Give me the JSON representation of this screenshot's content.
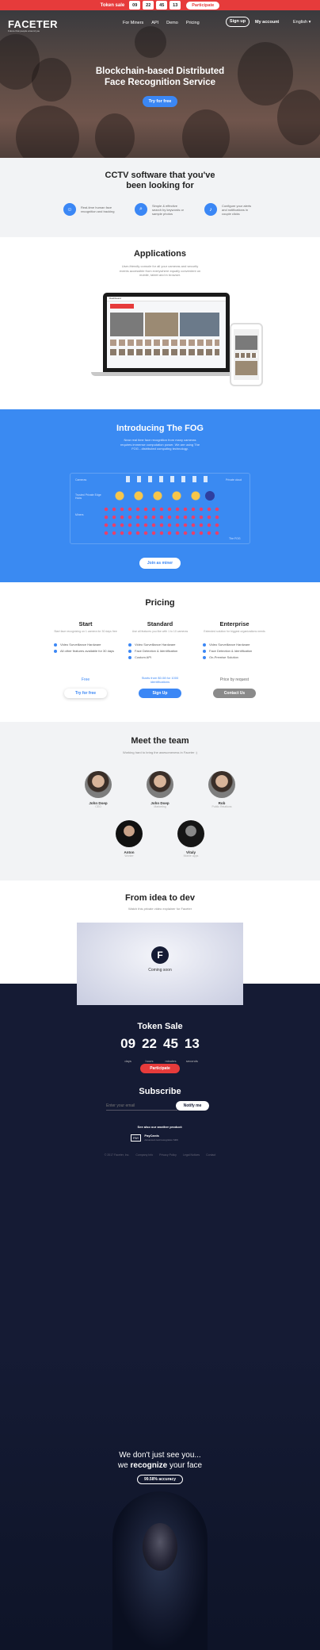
{
  "topbar": {
    "title": "Token sale",
    "days": "09",
    "days_lbl": "days",
    "hours": "22",
    "hours_lbl": "hours",
    "minutes": "45",
    "minutes_lbl": "minutes",
    "seconds": "13",
    "seconds_lbl": "seconds",
    "button": "Participate"
  },
  "nav": {
    "logo": "FACETER",
    "logo_tag": "Future that people around you",
    "links": [
      "For Miners",
      "API",
      "Demo",
      "Pricing"
    ],
    "signup": "Sign up",
    "account": "My account",
    "language": "English"
  },
  "hero": {
    "title_line1": "Blockchain-based Distributed",
    "title_line2": "Face Recognition Service",
    "cta": "Try for free"
  },
  "cctv": {
    "title_line1": "CCTV software that you've",
    "title_line2": "been looking for",
    "features": [
      {
        "icon": "user-icon",
        "text": "Real-time human face recognition and tracking"
      },
      {
        "icon": "search-icon",
        "text": "Simple & effective search by keywords or sample photos"
      },
      {
        "icon": "bell-icon",
        "text": "Configure your alerts and notifications in couple clicks"
      }
    ]
  },
  "applications": {
    "title": "Applications",
    "desc": "User-friendly console for all your cameras and security events accessible from everywhere equally convenient on mobile, tablet and in browser.",
    "screen_title": "Dashboard"
  },
  "fog": {
    "title": "Introducing The FOG",
    "desc": "Near real time face recognition from many cameras requires immense computation power. We are using The FOG - distributed computing technology.",
    "label_cameras": "Cameras",
    "label_trusted": "Trusted Private Edge Hubs",
    "label_miners": "Miners",
    "label_private": "Private cloud",
    "label_fog": "The FOG",
    "button": "Join as miner"
  },
  "pricing": {
    "title": "Pricing",
    "plans": [
      {
        "name": "Start",
        "desc": "Start face recognizing on 1 camera for 30 days free",
        "features": [
          "Video Surveillance Hardware",
          "All other features available for 30 days"
        ],
        "price": "Free",
        "button": "Try for free"
      },
      {
        "name": "Standard",
        "desc": "Use all features you like with 1 to 10 cameras",
        "features": [
          "Video Surveillance Hardware",
          "Face Detection & Identification",
          "Custom API"
        ],
        "price": "Starts from $0.08 for 1000 identifications",
        "button": "Sign Up"
      },
      {
        "name": "Enterprise",
        "desc": "Extended solution for biggest organizations needs",
        "features": [
          "Video Surveillance Hardware",
          "Face Detection & Identification",
          "On-Premise Solution"
        ],
        "price": "Price by request",
        "button": "Contact Us"
      }
    ]
  },
  "team": {
    "title": "Meet the team",
    "desc": "Working hard to bring the awesomeness in Faceter :)",
    "members": [
      {
        "name": "John Doep",
        "role": "CEO"
      },
      {
        "name": "John Doep",
        "role": "Marketing"
      },
      {
        "name": "Rob",
        "role": "Public Relations"
      },
      {
        "name": "Anton",
        "role": "Worker"
      },
      {
        "name": "Vitaly",
        "role": "Mobile apps"
      }
    ]
  },
  "video": {
    "title": "From idea to dev",
    "desc": "Watch this private video explainer for Faceter",
    "coming": "Coming soon"
  },
  "tokensale": {
    "title": "Token Sale",
    "days": "09",
    "days_lbl": "days",
    "hours": "22",
    "hours_lbl": "hours",
    "minutes": "45",
    "minutes_lbl": "minutes",
    "seconds": "13",
    "seconds_lbl": "seconds",
    "button": "Participate"
  },
  "subscribe": {
    "title": "Subscribe",
    "placeholder": "Enter your email",
    "button": "Notify me"
  },
  "products": {
    "title": "See also our another product:",
    "name": "PayCards",
    "desc": "Advanced card recognition SDK",
    "logo_text": "PAY"
  },
  "footer": {
    "links": [
      "© 2017 Faceter, Inc.",
      "Company Info",
      "Privacy Policy",
      "Legal Notices",
      "Contact"
    ]
  },
  "bottom": {
    "line1": "We don't just see you...",
    "line2_pre": "we",
    "line2_bold": "recognize",
    "line2_post": "your face",
    "badge": "99.58% accuracy"
  }
}
